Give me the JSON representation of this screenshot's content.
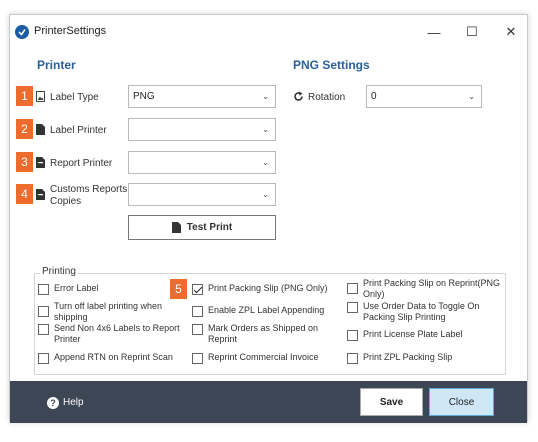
{
  "window": {
    "title": "PrinterSettings",
    "minimize": "—",
    "maximize": "☐",
    "close": "✕"
  },
  "colors": {
    "accent": "#2a5f99",
    "badge": "#ec6b2d",
    "footer": "#3c4654",
    "primary_button": "#cfe6f6"
  },
  "printer": {
    "title": "Printer",
    "fields": [
      {
        "badge": "1",
        "label": "Label Type",
        "value": "PNG",
        "icon": "image-file-icon"
      },
      {
        "badge": "2",
        "label": "Label Printer",
        "value": "",
        "icon": "file-icon"
      },
      {
        "badge": "3",
        "label": "Report Printer",
        "value": "",
        "icon": "file-icon"
      },
      {
        "badge": "4",
        "label_line1": "Customs Reports",
        "label_line2": "Copies",
        "value": "",
        "icon": "file-icon"
      }
    ],
    "test_print": "Test Print"
  },
  "png_settings": {
    "title": "PNG Settings",
    "rotation_label": "Rotation",
    "rotation_value": "0",
    "icon": "rotate-icon"
  },
  "printing": {
    "legend": "Printing",
    "badge": "5",
    "items": [
      {
        "line1": "Error Label",
        "checked": false
      },
      {
        "line1": "Turn off label printing when",
        "line2": "shipping",
        "checked": false
      },
      {
        "line1": "Send Non 4x6 Labels to Report",
        "line2": "Printer",
        "checked": false
      },
      {
        "line1": "Append RTN on Reprint Scan",
        "checked": false
      },
      {
        "line1": "Print Packing Slip (PNG Only)",
        "checked": true
      },
      {
        "line1": "Enable ZPL Label Appending",
        "checked": false
      },
      {
        "line1": "Mark Orders as Shipped on",
        "line2": "Reprint",
        "checked": false
      },
      {
        "line1": "Reprint Commercial Invoice",
        "checked": false
      },
      {
        "line1": "Print Packing Slip on Reprint(PNG",
        "line2": "Only)",
        "checked": false
      },
      {
        "line1": "Use Order Data to Toggle On",
        "line2": "Packing Slip Printing",
        "checked": false
      },
      {
        "line1": "Print License Plate Label",
        "checked": false
      },
      {
        "line1": "Print ZPL Packing Slip",
        "checked": false
      }
    ]
  },
  "footer": {
    "help": "Help",
    "save": "Save",
    "close": "Close"
  }
}
